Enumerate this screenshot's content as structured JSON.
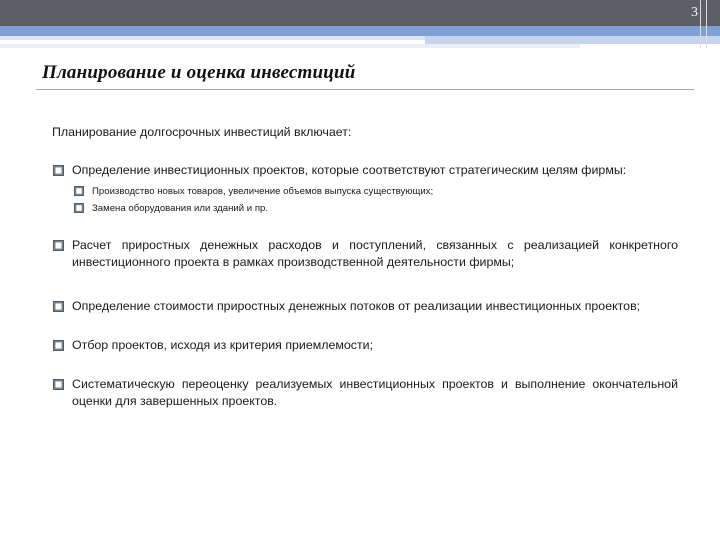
{
  "slide": {
    "number": "3",
    "title": "Планирование и оценка инвестиций"
  },
  "intro": "Планирование долгосрочных инвестиций включает:",
  "items": [
    {
      "text": "Определение инвестиционных проектов, которые соответствуют стратегическим целям фирмы:",
      "subitems": [
        "Производство новых товаров, увеличение объемов выпуска существующих;",
        "Замена оборудования или зданий и пр."
      ]
    },
    {
      "text": "Расчет приростных денежных расходов и поступлений, связанных с реализацией конкретного инвестиционного проекта в рамках производственной деятельности фирмы;"
    },
    {
      "text": "Определение стоимости приростных денежных потоков от реализации инвестиционных проектов;"
    },
    {
      "text": "Отбор проектов, исходя из критерия приемлемости;"
    },
    {
      "text": "Систематическую переоценку реализуемых инвестиционных проектов и выполнение окончательной оценки для завершенных проектов."
    }
  ],
  "colors": {
    "header_dark": "#5d5e66",
    "header_blue": "#7f9fd6",
    "bullet": "#7a8691"
  },
  "icons": {
    "bullet": "q-checkbox-bullet-icon"
  }
}
